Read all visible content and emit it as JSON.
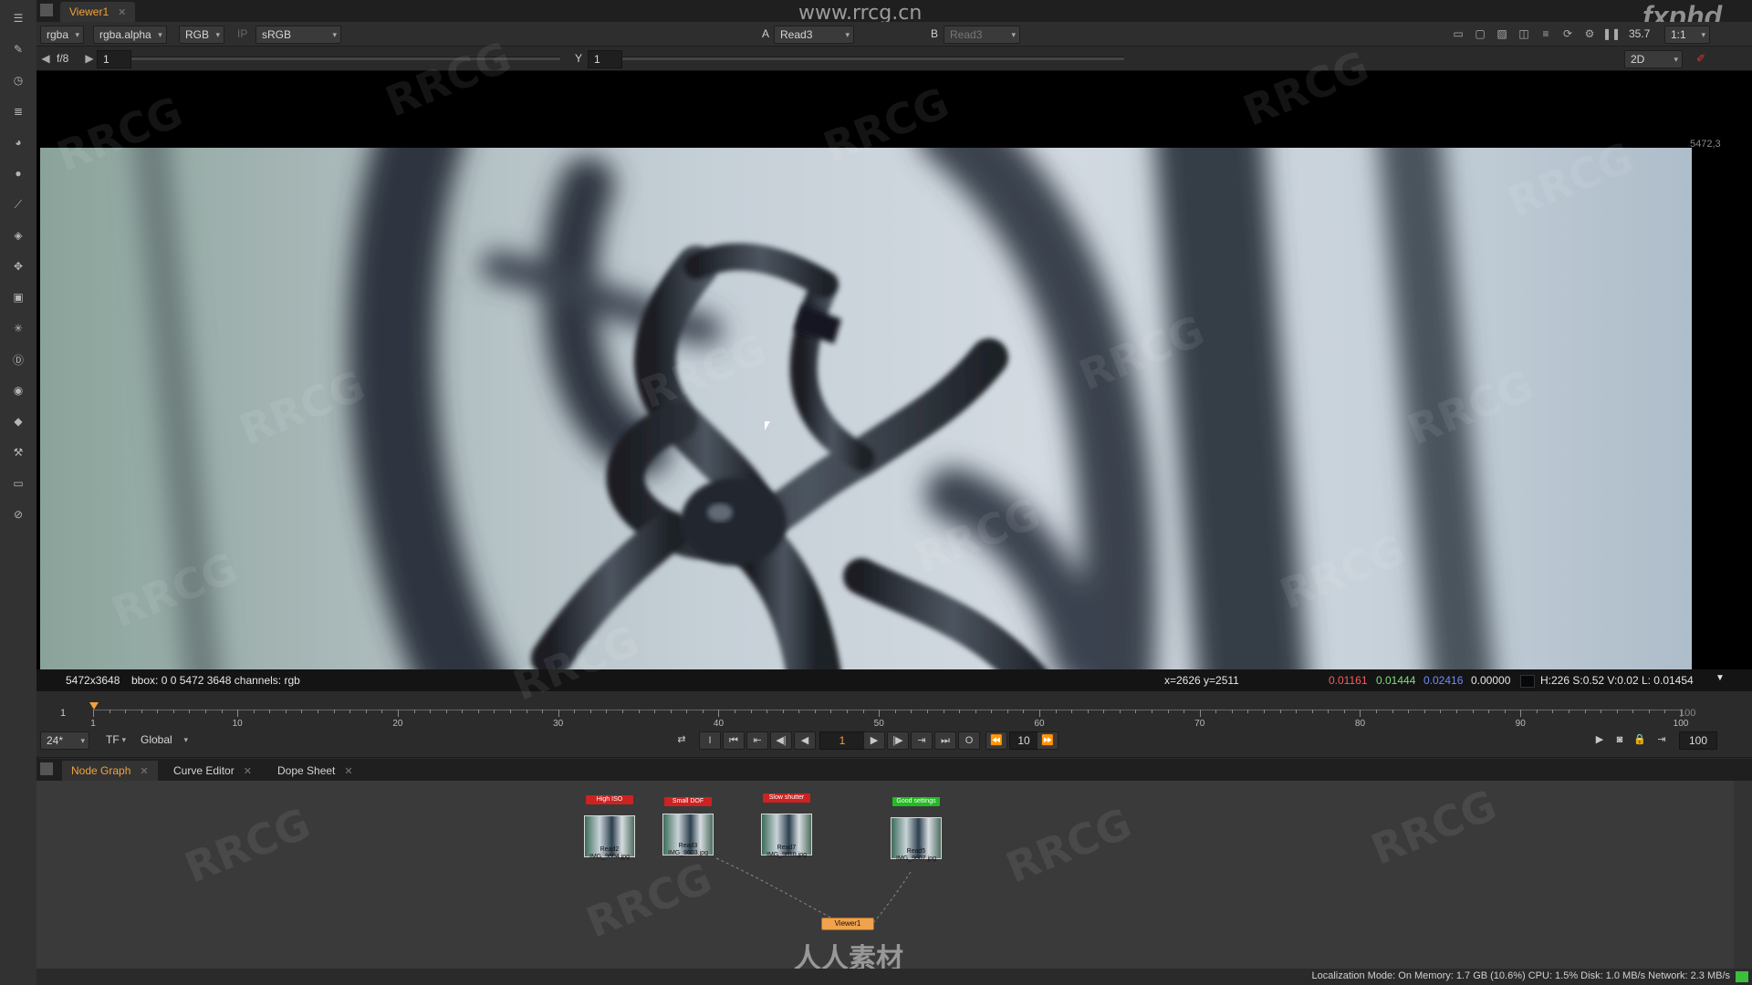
{
  "window": {
    "tab_label": "Viewer1"
  },
  "watermarks": {
    "site": "www.rrcg.cn",
    "brand": "fxphd",
    "bottom": "人人素材",
    "overlay": "RRCG"
  },
  "viewer_toolbar": {
    "channels": "rgba",
    "alpha": "rgba.alpha",
    "display": "RGB",
    "ip": "IP",
    "colorspace": "sRGB",
    "input_a_label": "A",
    "input_a": "Read3",
    "input_b_label": "B",
    "input_b": "Read3",
    "zoom": "35.7",
    "ratio": "1:1",
    "fstop": "f/8",
    "gain": "1",
    "gamma_label": "Y",
    "gamma": "1",
    "view_mode": "2D",
    "format_label": "5472,3"
  },
  "status_line": {
    "format": "5472x3648",
    "bbox": "bbox: 0 0 5472 3648 channels: rgb",
    "coords": "x=2626 y=2511",
    "r": "0.01161",
    "g": "0.01444",
    "b": "0.02416",
    "a": "0.00000",
    "hsvl": "H:226 S:0.52 V:0.02  L: 0.01454"
  },
  "timeline": {
    "start": "1",
    "end": "100",
    "ticks": [
      "1",
      "10",
      "20",
      "30",
      "40",
      "50",
      "60",
      "70",
      "80",
      "90",
      "100"
    ],
    "fps": "24*",
    "tf": "TF",
    "scope": "Global",
    "current_frame": "1",
    "step": "10",
    "end_frame": "100"
  },
  "node_tabs": [
    {
      "label": "Node Graph",
      "active": true
    },
    {
      "label": "Curve Editor",
      "active": false
    },
    {
      "label": "Dope Sheet",
      "active": false
    }
  ],
  "nodes": [
    {
      "backdrop": "High ISO",
      "color": "#cc2222",
      "name": "Read2",
      "file": "IMG_9604.jpg"
    },
    {
      "backdrop": "Small DOF",
      "color": "#cc2222",
      "name": "Read3",
      "file": "IMG_9603.jpg"
    },
    {
      "backdrop": "Slow shutter",
      "color": "#cc2222",
      "name": "Read7",
      "file": "IMG_9610.jpg"
    },
    {
      "backdrop": "Good settings",
      "color": "#22bb22",
      "name": "Read5",
      "file": "IMG_9607.jpg"
    }
  ],
  "viewer_node": "Viewer1",
  "bottom_status": "Localization Mode: On  Memory: 1.7 GB (10.6%)  CPU: 1.5%  Disk: 1.0 MB/s  Network: 2.3 MB/s",
  "accent_color": "#f2a23a"
}
